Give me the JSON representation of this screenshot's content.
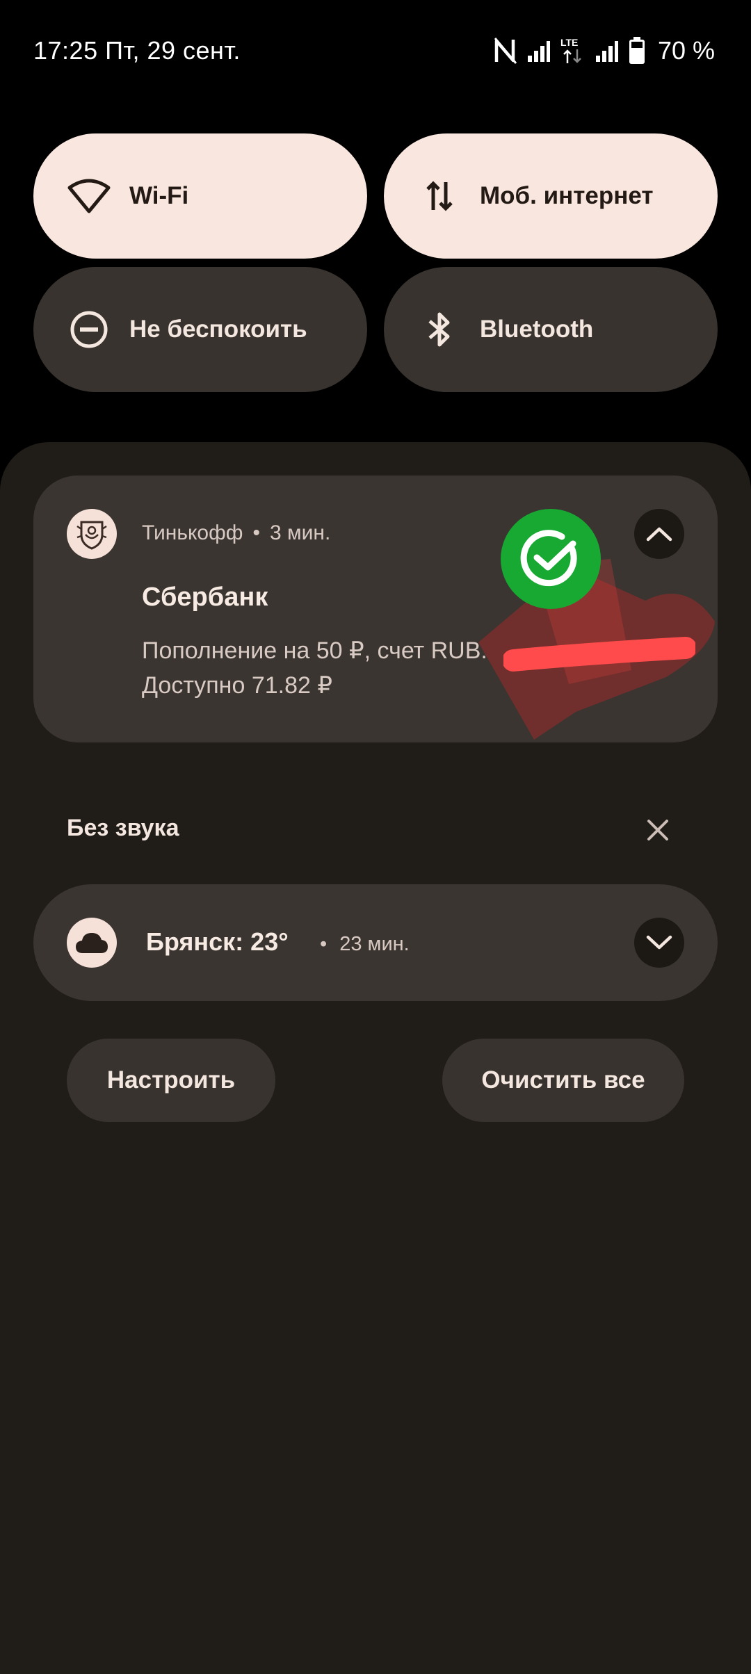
{
  "status_bar": {
    "time_date": "17:25 Пт, 29 сент.",
    "network_label": "LTE",
    "battery": "70 %"
  },
  "quick_settings": {
    "tiles": [
      {
        "label": "Wi-Fi",
        "icon": "wifi-icon",
        "state": "on"
      },
      {
        "label": "Моб. интернет",
        "icon": "mobile-data-icon",
        "state": "on"
      },
      {
        "label": "Не беспокоить",
        "icon": "do-not-disturb-icon",
        "state": "off"
      },
      {
        "label": "Bluetooth",
        "icon": "bluetooth-icon",
        "state": "off"
      }
    ]
  },
  "notification": {
    "app_name": "Тинькофф",
    "separator": "•",
    "time": "3 мин.",
    "title": "Сбербанк",
    "line1": "Пополнение на 50 ₽, счет RUB.",
    "line2": "Доступно 71.82 ₽",
    "app_icon": "tinkoff-crest-icon",
    "logo_icon": "sber-logo-icon"
  },
  "silent_section": {
    "title": "Без звука",
    "dismiss_icon": "close-icon"
  },
  "weather_notification": {
    "title": "Брянск: 23°",
    "separator": "•",
    "time": "23 мин.",
    "icon": "cloud-icon"
  },
  "actions": {
    "configure": "Настроить",
    "clear_all": "Очистить все"
  },
  "colors": {
    "tile_active": "#f9e6de",
    "tile_inactive": "#38332e",
    "shade_bg": "#201c18",
    "card_bg": "#3a3531",
    "sber_green": "#17a931",
    "redaction": "#ff4b4b"
  }
}
